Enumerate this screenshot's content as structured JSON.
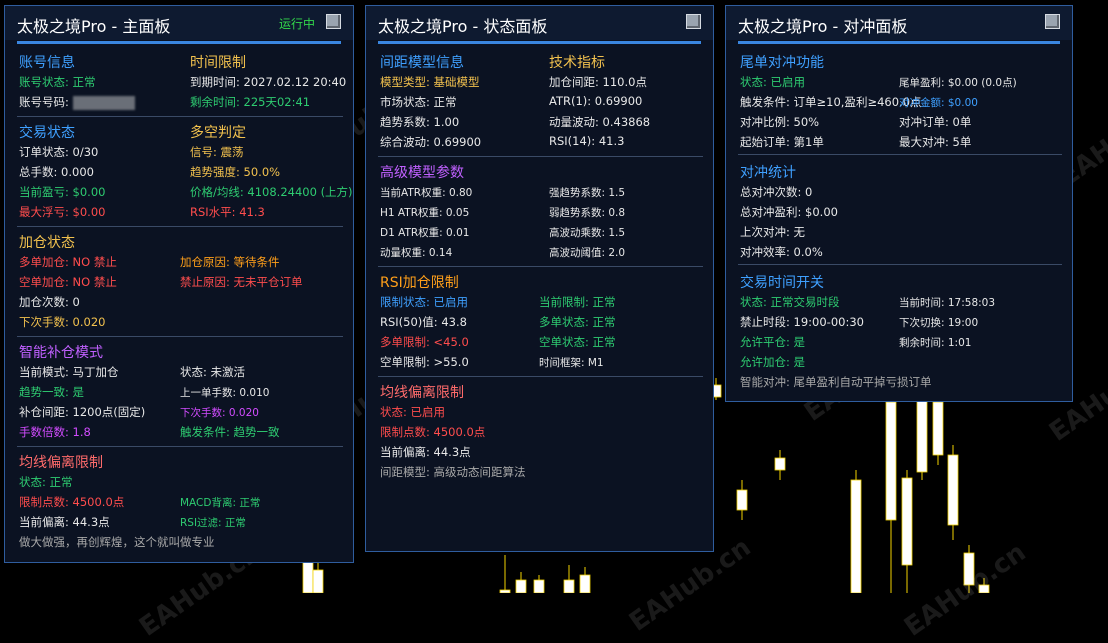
{
  "watermark": "EAHub.cn",
  "panels": {
    "main": {
      "title": "太极之境Pro - 主面板",
      "status_run": "运行中",
      "account": {
        "heading": "账号信息",
        "status": "账号状态: 正常",
        "number_label": "账号号码:"
      },
      "time_limit": {
        "heading": "时间限制",
        "expiry": "到期时间: 2027.02.12 20:40",
        "remaining": "剩余时间: 225天02:41"
      },
      "trade": {
        "heading": "交易状态",
        "orders": "订单状态: 0/30",
        "lots": "总手数: 0.000",
        "profit": "当前盈亏: $0.00",
        "max_float": "最大浮亏: $0.00"
      },
      "judge": {
        "heading": "多空判定",
        "signal": "信号: 震荡",
        "strength": "趋势强度: 50.0%",
        "price_ma": "价格/均线: 4108.24400 (上方)",
        "rsi": "RSI水平: 41.3"
      },
      "add": {
        "heading": "加仓状态",
        "long": "多单加仓: NO 禁止",
        "short": "空单加仓: NO 禁止",
        "reason": "加仓原因: 等待条件",
        "forbid": "禁止原因: 无未平仓订单",
        "count": "加仓次数: 0",
        "next_lots": "下次手数: 0.020"
      },
      "smart": {
        "heading": "智能补仓模式",
        "mode": "当前模式: 马丁加仓",
        "state": "状态: 未激活",
        "trend": "趋势一致: 是",
        "last_lots": "上一单手数: 0.010",
        "distance": "补仓间距: 1200点(固定)",
        "next_lots": "下次手数: 0.020",
        "multiplier": "手数倍数: 1.8",
        "trigger": "触发条件: 趋势一致"
      },
      "ma_dev": {
        "heading": "均线偏离限制",
        "state": "状态: 正常",
        "limit": "限制点数: 4500.0点",
        "macd": "MACD背离: 正常",
        "current": "当前偏离: 44.3点",
        "rsi_filter": "RSI过滤: 正常"
      },
      "slogan": "做大做强，再创辉煌，这个就叫做专业"
    },
    "status": {
      "title": "太极之境Pro - 状态面板",
      "spacing": {
        "heading": "间距模型信息",
        "type": "模型类型: 基础模型",
        "market": "市场状态: 正常",
        "trend": "趋势系数: 1.00",
        "vol": "综合波动: 0.69900"
      },
      "tech": {
        "heading": "技术指标",
        "spacing": "加仓间距: 110.0点",
        "atr": "ATR(1): 0.69900",
        "dyn": "动量波动: 0.43868",
        "rsi": "RSI(14): 41.3"
      },
      "advanced": {
        "heading": "高级模型参数",
        "cur_atr": "当前ATR权重: 0.80",
        "h1_atr": "H1 ATR权重: 0.05",
        "d1_atr": "D1 ATR权重: 0.01",
        "mom": "动量权重: 0.14",
        "strong": "强趋势系数: 1.5",
        "weak": "弱趋势系数: 0.8",
        "hv_mult": "高波动乘数: 1.5",
        "hv_thr": "高波动阈值: 2.0"
      },
      "rsi_add": {
        "heading": "RSI加仓限制",
        "state": "限制状态: 已启用",
        "cur_limit": "当前限制: 正常",
        "rsi50": "RSI(50)值: 43.8",
        "long_state": "多单状态: 正常",
        "long_limit": "多单限制: <45.0",
        "short_state": "空单状态: 正常",
        "short_limit": "空单限制: >55.0",
        "timeframe": "时间框架: M1"
      },
      "ma_dev": {
        "heading": "均线偏离限制",
        "state": "状态: 已启用",
        "limit": "限制点数: 4500.0点",
        "current": "当前偏离: 44.3点",
        "model": "间距模型: 高级动态间距算法"
      }
    },
    "hedge": {
      "title": "太极之境Pro - 对冲面板",
      "tail": {
        "heading": "尾单对冲功能",
        "state": "状态: 已启用",
        "tail_profit": "尾单盈利: $0.00 (0.0点)",
        "trigger": "触发条件: 订单≥10,盈利≥460.0点",
        "hedge_amount": "对冲金额: $0.00",
        "ratio": "对冲比例: 50%",
        "hedge_orders": "对冲订单: 0单",
        "start": "起始订单: 第1单",
        "max": "最大对冲: 5单"
      },
      "stats": {
        "heading": "对冲统计",
        "count": "总对冲次数: 0",
        "profit": "总对冲盈利: $0.00",
        "last": "上次对冲: 无",
        "eff": "对冲效率: 0.0%"
      },
      "time": {
        "heading": "交易时间开关",
        "state": "状态: 正常交易时段",
        "now": "当前时间: 17:58:03",
        "forbid": "禁止时段: 19:00-00:30",
        "next_switch": "下次切换: 19:00",
        "allow_close": "允许平仓: 是",
        "remain": "剩余时间: 1:01",
        "allow_add": "允许加仓: 是",
        "smart_hedge": "智能对冲:  尾单盈利自动平掉亏损订单"
      }
    }
  },
  "chart_data": {
    "type": "candlestick",
    "colors": {
      "candle": "#ffffff",
      "wick": "#f2d200",
      "background": "#000000"
    }
  }
}
